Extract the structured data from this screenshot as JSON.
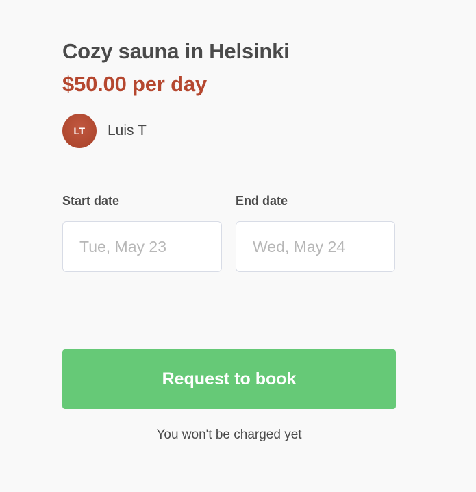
{
  "listing": {
    "title": "Cozy sauna in Helsinki",
    "price": "$50.00 per day",
    "author": {
      "initials": "LT",
      "name": "Luis T"
    }
  },
  "booking": {
    "start_date": {
      "label": "Start date",
      "placeholder": "Tue, May 23"
    },
    "end_date": {
      "label": "End date",
      "placeholder": "Wed, May 24"
    },
    "submit_label": "Request to book",
    "note": "You won't be charged yet"
  },
  "colors": {
    "background": "#f9f9f9",
    "text": "#4a4a4a",
    "price": "#b5472f",
    "avatar": "#a84229",
    "button": "#66c977",
    "input_border": "#d8dce6",
    "placeholder": "#b7b7b7"
  }
}
